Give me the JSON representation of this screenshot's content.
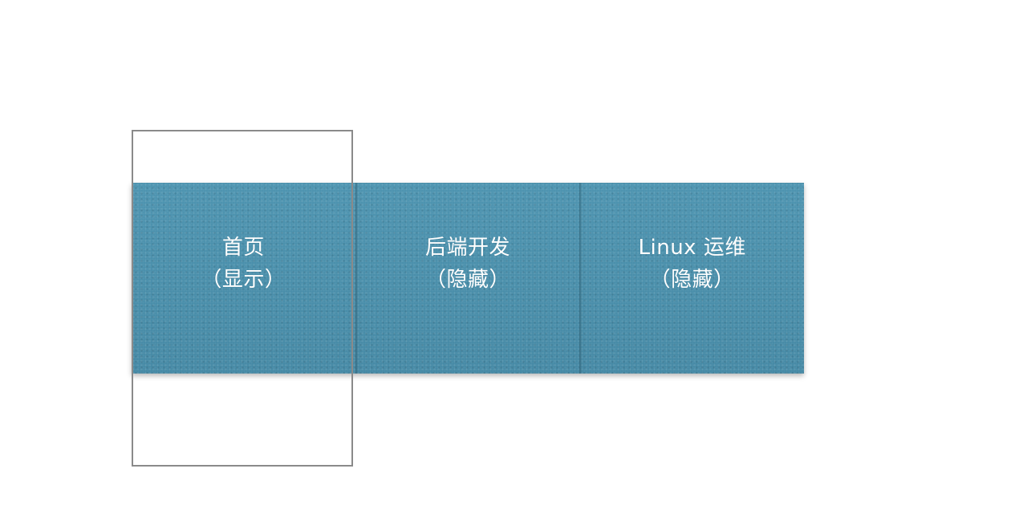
{
  "panels": [
    {
      "title": "首页",
      "status": "（显示）",
      "visible": true
    },
    {
      "title": "后端开发",
      "status": "（隐藏）",
      "visible": false
    },
    {
      "title": "Linux 运维",
      "status": "（隐藏）",
      "visible": false
    }
  ],
  "colors": {
    "panel_fill": "#4a8fab",
    "frame_border": "#8a8a8a",
    "text": "#ffffff"
  }
}
